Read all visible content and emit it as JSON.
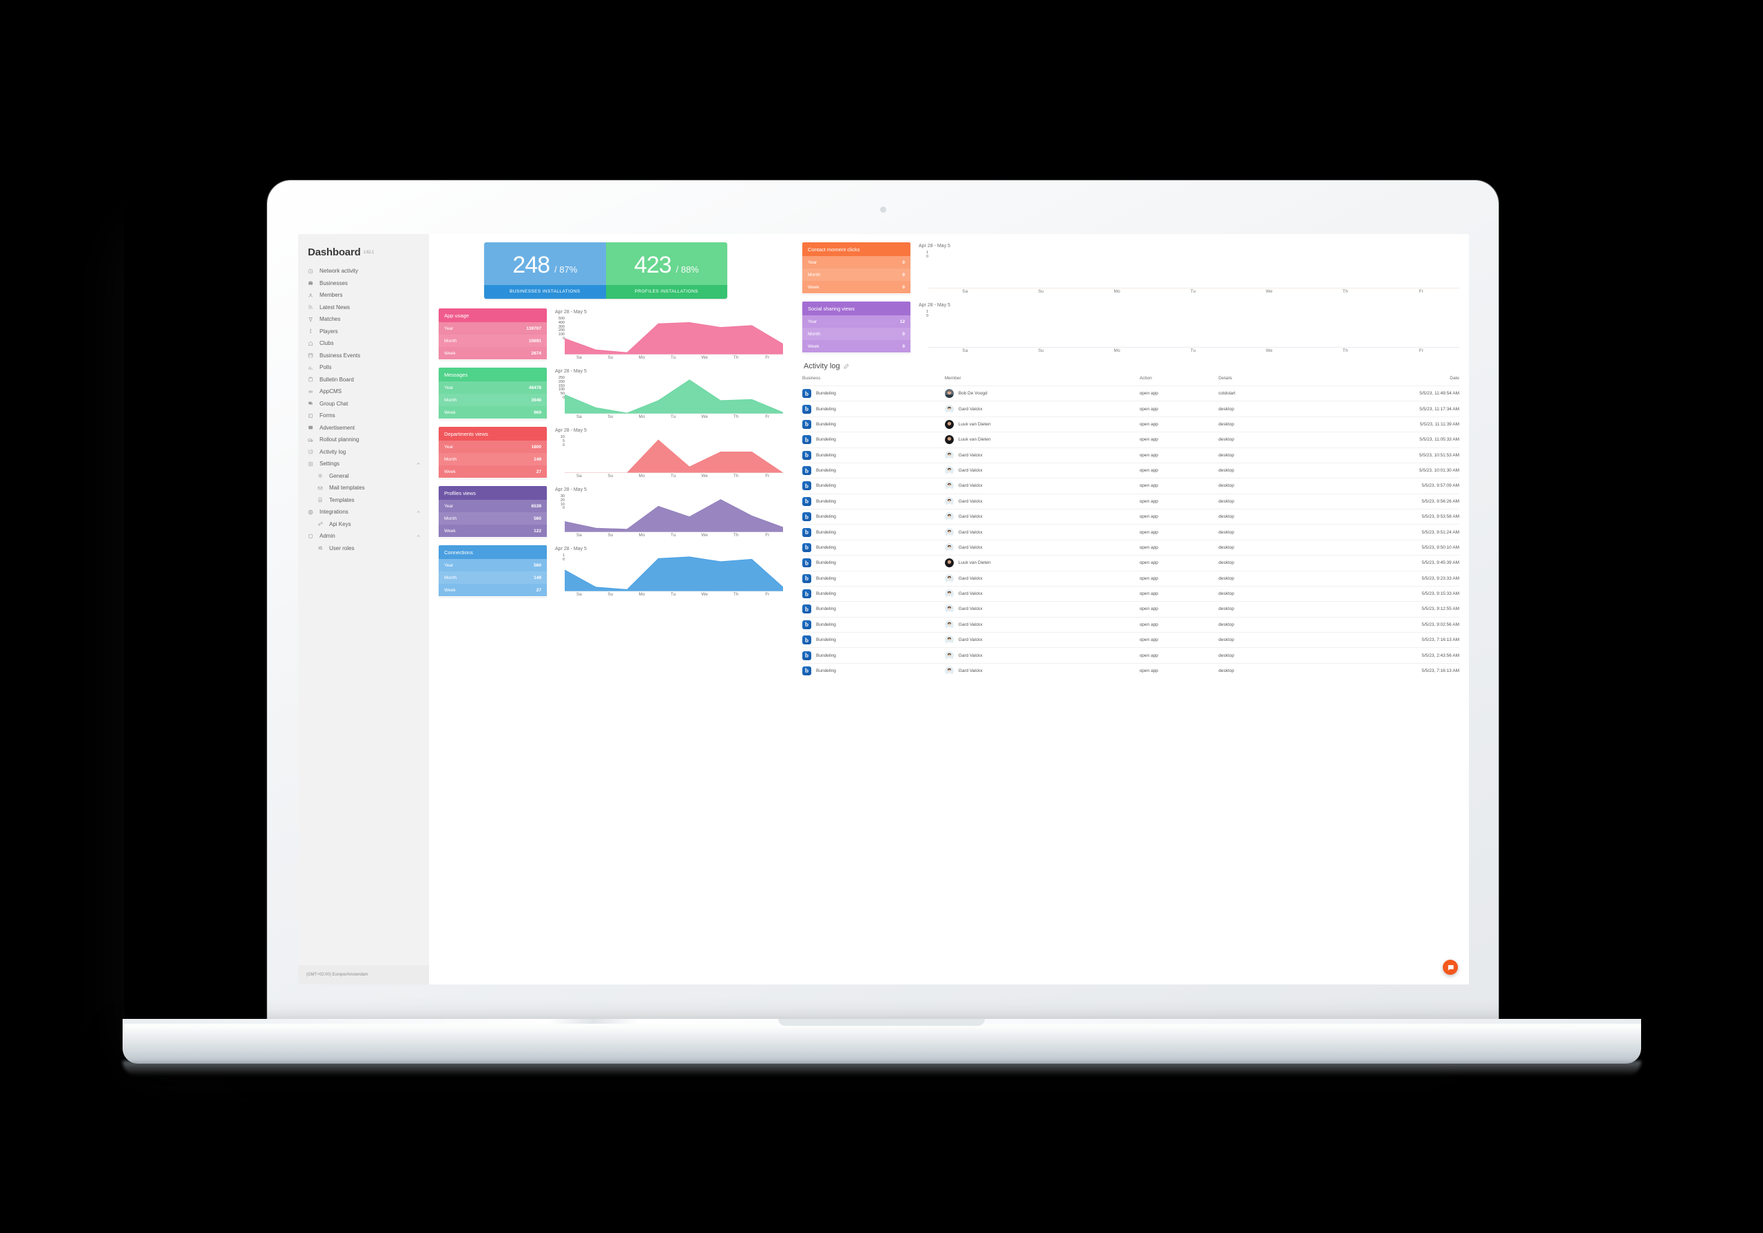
{
  "sidebar": {
    "title": "Dashboard",
    "version": "1.62.1",
    "timezone": "(GMT+02:00) Europe/Amsterdam",
    "items": [
      {
        "label": "Network activity",
        "icon": "clock-icon",
        "level": 0,
        "caret": false
      },
      {
        "label": "Businesses",
        "icon": "briefcase-icon",
        "level": 0,
        "caret": false
      },
      {
        "label": "Members",
        "icon": "user-icon",
        "level": 0,
        "caret": false
      },
      {
        "label": "Latest News",
        "icon": "rss-icon",
        "level": 0,
        "caret": false
      },
      {
        "label": "Matches",
        "icon": "trophy-icon",
        "level": 0,
        "caret": false
      },
      {
        "label": "Players",
        "icon": "player-icon",
        "level": 0,
        "caret": false
      },
      {
        "label": "Clubs",
        "icon": "home-icon",
        "level": 0,
        "caret": false
      },
      {
        "label": "Business Events",
        "icon": "calendar-icon",
        "level": 0,
        "caret": false
      },
      {
        "label": "Polls",
        "icon": "bar-chart-icon",
        "level": 0,
        "caret": false
      },
      {
        "label": "Bulletin Board",
        "icon": "clipboard-icon",
        "level": 0,
        "caret": false
      },
      {
        "label": "AppCMS",
        "icon": "link-icon",
        "level": 0,
        "caret": false
      },
      {
        "label": "Group Chat",
        "icon": "chat-icon",
        "level": 0,
        "caret": false
      },
      {
        "label": "Forms",
        "icon": "form-icon",
        "level": 0,
        "caret": false
      },
      {
        "label": "Advertisement",
        "icon": "image-icon",
        "level": 0,
        "caret": false
      },
      {
        "label": "Rollout planning",
        "icon": "truck-icon",
        "level": 0,
        "caret": false
      },
      {
        "label": "Activity log",
        "icon": "history-icon",
        "level": 0,
        "caret": false
      },
      {
        "label": "Settings",
        "icon": "settings-box-icon",
        "level": 0,
        "caret": true
      },
      {
        "label": "General",
        "icon": "gear-icon",
        "level": 1,
        "caret": false
      },
      {
        "label": "Mail templates",
        "icon": "mail-icon",
        "level": 1,
        "caret": false
      },
      {
        "label": "Templates",
        "icon": "file-icon",
        "level": 1,
        "caret": false
      },
      {
        "label": "Integrations",
        "icon": "globe-icon",
        "level": 0,
        "caret": true
      },
      {
        "label": "Api Keys",
        "icon": "key-icon",
        "level": 1,
        "caret": false
      },
      {
        "label": "Admin",
        "icon": "shield-icon",
        "level": 0,
        "caret": true
      },
      {
        "label": "User roles",
        "icon": "sliders-icon",
        "level": 1,
        "caret": false
      }
    ]
  },
  "hero": [
    {
      "value": "248",
      "pct": "/ 87%",
      "label": "BUSINESSES  INSTALLATIONS",
      "color_top": "#6ab0e4",
      "color_bottom": "#2b90d9"
    },
    {
      "value": "423",
      "pct": "/ 88%",
      "label": "PROFILES INSTALLATIONS",
      "color_top": "#68d78f",
      "color_bottom": "#36c270"
    }
  ],
  "metrics": [
    {
      "title": "App usage",
      "range": "Apr 28 - May 5",
      "rows": [
        {
          "label": "Year",
          "value": "139707"
        },
        {
          "label": "Month",
          "value": "10691"
        },
        {
          "label": "Week",
          "value": "2674"
        }
      ],
      "head_color": "#ef5b8c",
      "body_color": "#f391ad",
      "alt_color": "#f08aa7",
      "chart_color": "#f2789f",
      "yticks": [
        "500",
        "400",
        "300",
        "200",
        "100",
        "0"
      ]
    },
    {
      "title": "Messages",
      "range": "Apr 28 - May 5",
      "rows": [
        {
          "label": "Year",
          "value": "48478"
        },
        {
          "label": "Month",
          "value": "3946"
        },
        {
          "label": "Week",
          "value": "969"
        }
      ],
      "head_color": "#4fd28a",
      "body_color": "#7ddcab",
      "alt_color": "#72d9a2",
      "chart_color": "#6fd8a4",
      "yticks": [
        "250",
        "200",
        "150",
        "100",
        "50",
        "0"
      ]
    },
    {
      "title": "Departments views",
      "range": "Apr 28 - May 5",
      "rows": [
        {
          "label": "Year",
          "value": "1800"
        },
        {
          "label": "Month",
          "value": "149"
        },
        {
          "label": "Week",
          "value": "27"
        }
      ],
      "head_color": "#f0575c",
      "body_color": "#f4868a",
      "alt_color": "#f27b80",
      "chart_color": "#f38084",
      "yticks": [
        "10",
        "5",
        "0"
      ]
    },
    {
      "title": "Profiles views",
      "range": "Apr 28 - May 5",
      "rows": [
        {
          "label": "Year",
          "value": "6539"
        },
        {
          "label": "Month",
          "value": "560"
        },
        {
          "label": "Week",
          "value": "122"
        }
      ],
      "head_color": "#6f57a6",
      "body_color": "#9a88c2",
      "alt_color": "#8f7cbb",
      "chart_color": "#9380bd",
      "yticks": [
        "30",
        "20",
        "10",
        "0"
      ]
    },
    {
      "title": "Connections",
      "range": "Apr 28 - May 5",
      "rows": [
        {
          "label": "Year",
          "value": "560"
        },
        {
          "label": "Month",
          "value": "149"
        },
        {
          "label": "Week",
          "value": "27"
        }
      ],
      "head_color": "#4a9fe0",
      "body_color": "#8cc4ee",
      "alt_color": "#7fbdec",
      "chart_color": "#4fa3e3",
      "yticks": [
        "1",
        "0"
      ]
    }
  ],
  "right_metrics": [
    {
      "title": "Contact moment clicks",
      "range": "Apr 28 - May 5",
      "rows": [
        {
          "label": "Year",
          "value": "0"
        },
        {
          "label": "Month",
          "value": "0"
        },
        {
          "label": "Week",
          "value": "0"
        }
      ],
      "head_color": "#f9763f",
      "body_color": "#fbaa84",
      "alt_color": "#fba077",
      "chart_color": "#f9763f",
      "yticks": [
        "1",
        "0"
      ]
    },
    {
      "title": "Social sharing views",
      "range": "Apr 28 - May 5",
      "rows": [
        {
          "label": "Year",
          "value": "12"
        },
        {
          "label": "Month",
          "value": "0"
        },
        {
          "label": "Week",
          "value": "0"
        }
      ],
      "head_color": "#a36ed2",
      "body_color": "#c9a2e6",
      "alt_color": "#c196e2",
      "chart_color": "#a36ed2",
      "yticks": [
        "1",
        "0"
      ]
    }
  ],
  "activity_log": {
    "title": "Activity log",
    "columns": [
      "Business",
      "Member",
      "Action",
      "Details",
      "Date"
    ],
    "rows": [
      {
        "business": "Bundeling",
        "member": "Bob De Voogd",
        "avatar": "male-dark",
        "action": "open app",
        "details": "coldstart",
        "date": "5/5/23, 11:49:54 AM"
      },
      {
        "business": "Bundeling",
        "member": "Gard Valckx",
        "avatar": "female",
        "action": "open app",
        "details": "desktop",
        "date": "5/5/23, 11:17:34 AM"
      },
      {
        "business": "Bundeling",
        "member": "Luuk van Dieten",
        "avatar": "male-bald",
        "action": "open app",
        "details": "desktop",
        "date": "5/5/23, 11:11:39 AM"
      },
      {
        "business": "Bundeling",
        "member": "Luuk van Dieten",
        "avatar": "male-bald",
        "action": "open app",
        "details": "desktop",
        "date": "5/5/23, 11:05:33 AM"
      },
      {
        "business": "Bundeling",
        "member": "Gard Valckx",
        "avatar": "female",
        "action": "open app",
        "details": "desktop",
        "date": "5/5/23, 10:51:53 AM"
      },
      {
        "business": "Bundeling",
        "member": "Gard Valckx",
        "avatar": "female",
        "action": "open app",
        "details": "desktop",
        "date": "5/5/23, 10:01:30 AM"
      },
      {
        "business": "Bundeling",
        "member": "Gard Valckx",
        "avatar": "female",
        "action": "open app",
        "details": "desktop",
        "date": "5/5/23, 9:57:09 AM"
      },
      {
        "business": "Bundeling",
        "member": "Gard Valckx",
        "avatar": "female",
        "action": "open app",
        "details": "desktop",
        "date": "5/5/23, 9:56:26 AM"
      },
      {
        "business": "Bundeling",
        "member": "Gard Valckx",
        "avatar": "female",
        "action": "open app",
        "details": "desktop",
        "date": "5/5/23, 9:53:58 AM"
      },
      {
        "business": "Bundeling",
        "member": "Gard Valckx",
        "avatar": "female",
        "action": "open app",
        "details": "desktop",
        "date": "5/5/23, 9:51:24 AM"
      },
      {
        "business": "Bundeling",
        "member": "Gard Valckx",
        "avatar": "female",
        "action": "open app",
        "details": "desktop",
        "date": "5/5/23, 9:50:10 AM"
      },
      {
        "business": "Bundeling",
        "member": "Luuk van Dieten",
        "avatar": "male-bald",
        "action": "open app",
        "details": "desktop",
        "date": "5/5/23, 9:45:39 AM"
      },
      {
        "business": "Bundeling",
        "member": "Gard Valckx",
        "avatar": "female",
        "action": "open app",
        "details": "desktop",
        "date": "5/5/23, 9:23:33 AM"
      },
      {
        "business": "Bundeling",
        "member": "Gard Valckx",
        "avatar": "female",
        "action": "open app",
        "details": "desktop",
        "date": "5/5/23, 9:15:33 AM"
      },
      {
        "business": "Bundeling",
        "member": "Gard Valckx",
        "avatar": "female",
        "action": "open app",
        "details": "desktop",
        "date": "5/5/23, 9:12:55 AM"
      },
      {
        "business": "Bundeling",
        "member": "Gard Valckx",
        "avatar": "female",
        "action": "open app",
        "details": "desktop",
        "date": "5/5/23, 9:02:56 AM"
      },
      {
        "business": "Bundeling",
        "member": "Gard Valckx",
        "avatar": "female",
        "action": "open app",
        "details": "desktop",
        "date": "5/5/23, 7:16:13 AM"
      },
      {
        "business": "Bundeling",
        "member": "Gard Valckx",
        "avatar": "female",
        "action": "open app",
        "details": "desktop",
        "date": "5/5/23, 2:43:56 AM"
      },
      {
        "business": "Bundeling",
        "member": "Gard Valckx",
        "avatar": "female",
        "action": "open app",
        "details": "desktop",
        "date": "5/5/23, 7:16:13 AM"
      }
    ]
  },
  "support": {
    "icon": "chat-bubble-icon",
    "color": "#f3581d"
  },
  "chart_data": [
    {
      "type": "area",
      "title": "App usage",
      "subtitle": "Apr 28 - May 5",
      "xlabel": "",
      "ylabel": "",
      "grid": false,
      "legend": "none",
      "categories": [
        "Fr",
        "Sa",
        "Su",
        "Mo",
        "Tu",
        "We",
        "Th",
        "Fr"
      ],
      "x": [
        "Fr",
        "Sa",
        "Su",
        "Mo",
        "Tu",
        "We",
        "Th",
        "Fr"
      ],
      "values": [
        260,
        75,
        30,
        500,
        520,
        440,
        470,
        170
      ],
      "ylim": [
        0,
        560
      ],
      "yticks": [
        0,
        100,
        200,
        300,
        400,
        500
      ],
      "color": "#f2789f"
    },
    {
      "type": "area",
      "title": "Messages",
      "subtitle": "Apr 28 - May 5",
      "xlabel": "",
      "ylabel": "",
      "grid": false,
      "legend": "none",
      "categories": [
        "Fr",
        "Sa",
        "Su",
        "Mo",
        "Tu",
        "We",
        "Th",
        "Fr"
      ],
      "x": [
        "Fr",
        "Sa",
        "Su",
        "Mo",
        "Tu",
        "We",
        "Th",
        "Fr"
      ],
      "values": [
        160,
        50,
        5,
        110,
        285,
        110,
        120,
        10
      ],
      "ylim": [
        0,
        290
      ],
      "yticks": [
        0,
        50,
        100,
        150,
        200,
        250
      ],
      "color": "#6fd8a4"
    },
    {
      "type": "area",
      "title": "Departments views",
      "subtitle": "Apr 28 - May 5",
      "xlabel": "",
      "ylabel": "",
      "grid": false,
      "legend": "none",
      "categories": [
        "Fr",
        "Sa",
        "Su",
        "Mo",
        "Tu",
        "We",
        "Th",
        "Fr"
      ],
      "x": [
        "Fr",
        "Sa",
        "Su",
        "Mo",
        "Tu",
        "We",
        "Th",
        "Fr"
      ],
      "values": [
        0,
        0,
        0,
        11,
        2,
        7,
        7,
        0
      ],
      "ylim": [
        0,
        11.5
      ],
      "yticks": [
        0,
        5,
        10
      ],
      "color": "#f38084"
    },
    {
      "type": "area",
      "title": "Profiles views",
      "subtitle": "Apr 28 - May 5",
      "xlabel": "",
      "ylabel": "",
      "grid": false,
      "legend": "none",
      "categories": [
        "Fr",
        "Sa",
        "Su",
        "Mo",
        "Tu",
        "We",
        "Th",
        "Fr"
      ],
      "x": [
        "Fr",
        "Sa",
        "Su",
        "Mo",
        "Tu",
        "We",
        "Th",
        "Fr"
      ],
      "values": [
        11,
        4,
        3,
        27,
        16,
        34,
        17,
        5
      ],
      "ylim": [
        0,
        36
      ],
      "yticks": [
        0,
        10,
        20,
        30
      ],
      "color": "#9380bd"
    },
    {
      "type": "area",
      "title": "Connections",
      "subtitle": "Apr 28 - May 5",
      "xlabel": "",
      "ylabel": "",
      "grid": false,
      "legend": "none",
      "categories": [
        "Fr",
        "Sa",
        "Su",
        "Mo",
        "Tu",
        "We",
        "Th",
        "Fr"
      ],
      "x": [
        "Fr",
        "Sa",
        "Su",
        "Mo",
        "Tu",
        "We",
        "Th",
        "Fr"
      ],
      "values": [
        0.62,
        0.12,
        0.05,
        0.95,
        1.0,
        0.86,
        0.93,
        0.12
      ],
      "ylim": [
        0,
        1
      ],
      "yticks": [
        0,
        1
      ],
      "color": "#4fa3e3"
    },
    {
      "type": "area",
      "title": "Contact moment clicks",
      "subtitle": "Apr 28 - May 5",
      "xlabel": "",
      "ylabel": "",
      "grid": false,
      "legend": "none",
      "categories": [
        "Fr",
        "Sa",
        "Su",
        "Mo",
        "Tu",
        "We",
        "Th",
        "Fr"
      ],
      "x": [
        "Fr",
        "Sa",
        "Su",
        "Mo",
        "Tu",
        "We",
        "Th",
        "Fr"
      ],
      "values": [
        0,
        0,
        0,
        0,
        0,
        0,
        0,
        0
      ],
      "ylim": [
        0,
        1
      ],
      "yticks": [
        0,
        1
      ],
      "color": "#f9763f"
    },
    {
      "type": "area",
      "title": "Social sharing views",
      "subtitle": "Apr 28 - May 5",
      "xlabel": "",
      "ylabel": "",
      "grid": false,
      "legend": "none",
      "categories": [
        "Fr",
        "Sa",
        "Su",
        "Mo",
        "Tu",
        "We",
        "Th",
        "Fr"
      ],
      "x": [
        "Fr",
        "Sa",
        "Su",
        "Mo",
        "Tu",
        "We",
        "Th",
        "Fr"
      ],
      "values": [
        0,
        0,
        0,
        0,
        0,
        0,
        0,
        0
      ],
      "ylim": [
        0,
        1
      ],
      "yticks": [
        0,
        1
      ],
      "color": "#a36ed2"
    }
  ]
}
